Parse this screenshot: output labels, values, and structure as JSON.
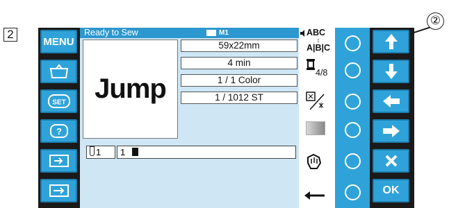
{
  "figure": {
    "step_number": "2",
    "callout_number": "②"
  },
  "left_menu": {
    "menu_label": "MENU",
    "items": [
      "menu-button",
      "load-button",
      "set-button",
      "help-button",
      "edit-button",
      "transfer-button"
    ]
  },
  "status": {
    "text": "Ready to Sew",
    "memory_label": "M1"
  },
  "preview": {
    "text": "Jump"
  },
  "info": {
    "size": "59x22mm",
    "time": "4 min",
    "color": "1 / 1 Color",
    "stitches": "1 / 1012 ST"
  },
  "thread_bar": {
    "needle": "1",
    "color_index": "1"
  },
  "icon_column": {
    "abc_top": "ABC",
    "abc_bottom": "A|B|C",
    "ratio": "4/8"
  },
  "right_buttons": {
    "ok_label": "OK"
  }
}
